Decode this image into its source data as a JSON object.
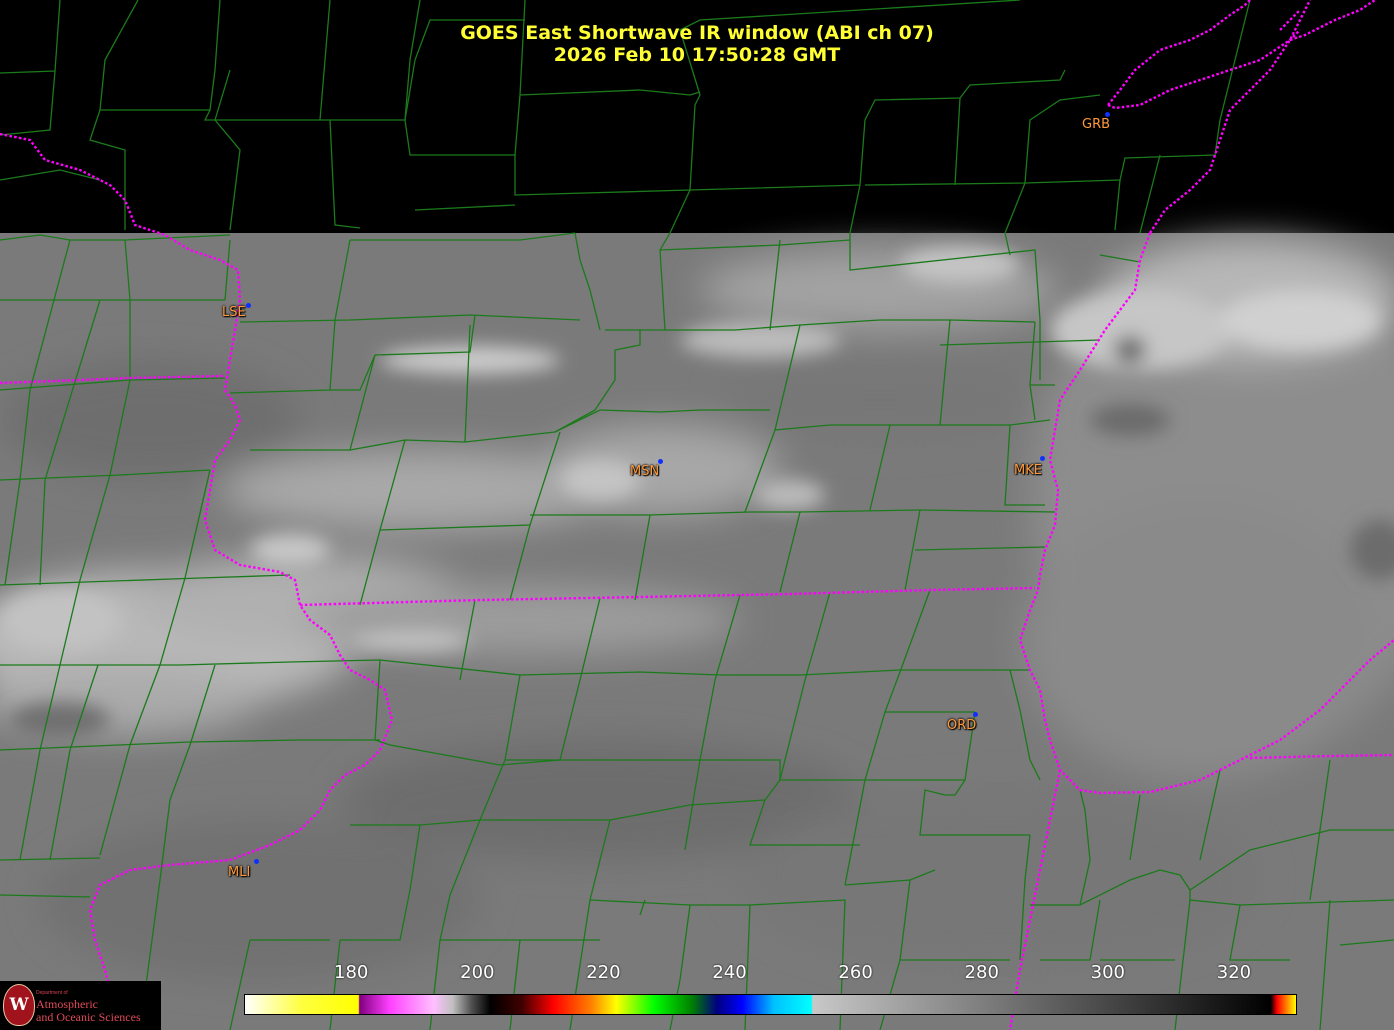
{
  "title": {
    "line1": "GOES East Shortwave IR window (ABI ch 07)",
    "line2": "2026 Feb 10  17:50:28 GMT"
  },
  "stations": [
    {
      "id": "grb",
      "label": "GRB"
    },
    {
      "id": "lse",
      "label": "LSE"
    },
    {
      "id": "msn",
      "label": "MSN"
    },
    {
      "id": "mke",
      "label": "MKE"
    },
    {
      "id": "ord",
      "label": "ORD"
    },
    {
      "id": "mli",
      "label": "MLI"
    }
  ],
  "colorbar": {
    "ticks": [
      "180",
      "200",
      "220",
      "240",
      "260",
      "280",
      "300",
      "320"
    ],
    "tick_values": [
      180,
      200,
      220,
      240,
      260,
      280,
      300,
      320
    ],
    "range": [
      163,
      330
    ],
    "stops": [
      {
        "v": 163,
        "c": "#ffffff"
      },
      {
        "v": 172,
        "c": "#ffff40"
      },
      {
        "v": 181,
        "c": "#ffff00"
      },
      {
        "v": 181.2,
        "c": "#800080"
      },
      {
        "v": 186,
        "c": "#ff40ff"
      },
      {
        "v": 193,
        "c": "#ffc0ff"
      },
      {
        "v": 196,
        "c": "#c0c0c0"
      },
      {
        "v": 199,
        "c": "#505050"
      },
      {
        "v": 202,
        "c": "#000000"
      },
      {
        "v": 207,
        "c": "#400000"
      },
      {
        "v": 212,
        "c": "#ff0000"
      },
      {
        "v": 218,
        "c": "#ff8000"
      },
      {
        "v": 222,
        "c": "#ffff00"
      },
      {
        "v": 228,
        "c": "#00ff00"
      },
      {
        "v": 234,
        "c": "#008000"
      },
      {
        "v": 238,
        "c": "#000080"
      },
      {
        "v": 242,
        "c": "#0000ff"
      },
      {
        "v": 247,
        "c": "#00c0ff"
      },
      {
        "v": 253,
        "c": "#00ffff"
      },
      {
        "v": 253.2,
        "c": "#c8c8c8"
      },
      {
        "v": 320,
        "c": "#111111"
      },
      {
        "v": 326,
        "c": "#000000"
      },
      {
        "v": 327,
        "c": "#ff0000"
      },
      {
        "v": 330,
        "c": "#ffff00"
      }
    ]
  },
  "colors": {
    "title": "#ffff33",
    "county_lines": "#1b7a1b",
    "state_lines": "#ff00ff",
    "station_label": "#ff9a3c",
    "station_dot": "#1030ff"
  },
  "logo": {
    "seal_letter": "W",
    "small": "Department of",
    "line1": "Atmospheric",
    "line2": "and Oceanic Sciences"
  }
}
